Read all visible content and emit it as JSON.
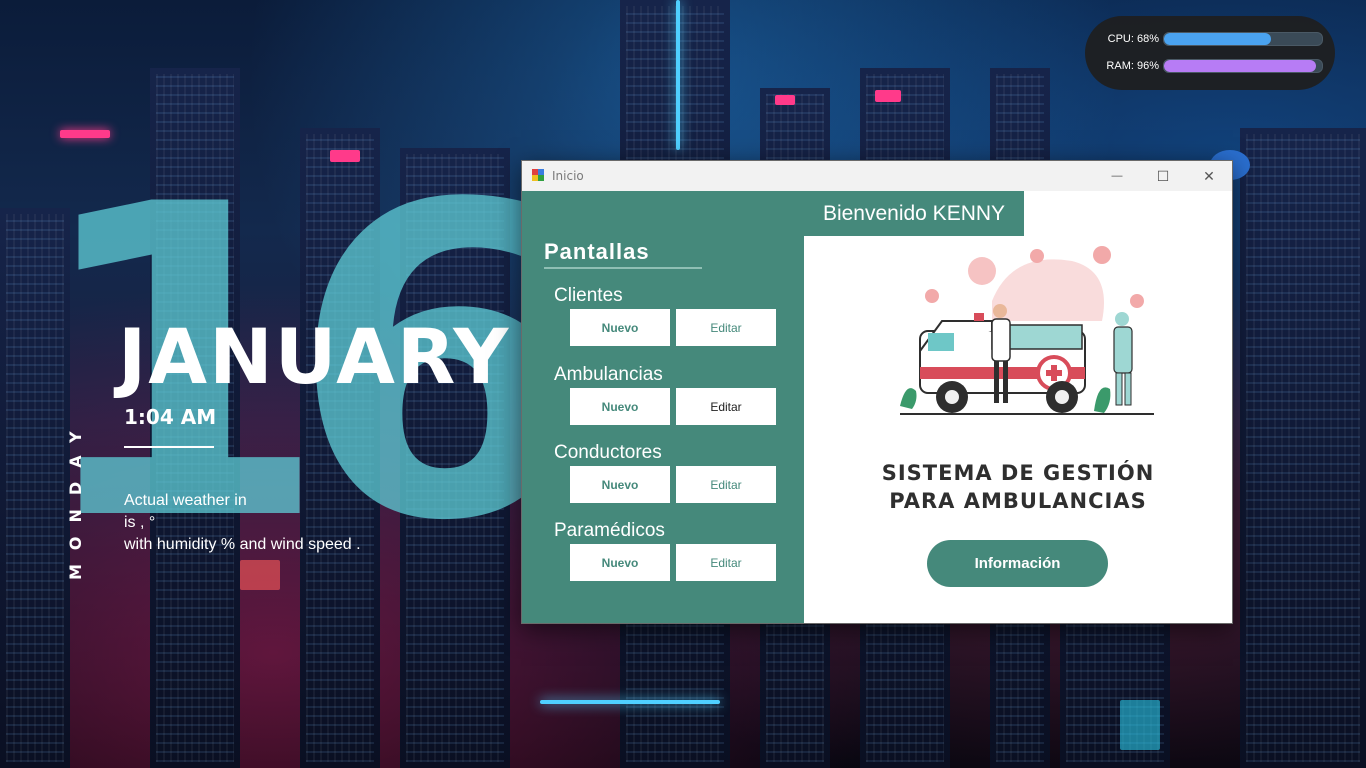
{
  "desktop": {
    "day_number": "16",
    "month": "JANUARY",
    "time": "1:04 AM",
    "weekday": "MONDAY",
    "weather": {
      "line1": "Actual weather in",
      "line2": "is , °",
      "line3": "with humidity  % and wind speed  ."
    }
  },
  "system_monitor": {
    "cpu": {
      "label": "CPU: 68%",
      "value_percent": 68,
      "color": "#4aa3f0"
    },
    "ram": {
      "label": "RAM: 96%",
      "value_percent": 96,
      "color": "#b77cf5"
    }
  },
  "window": {
    "title": "Inicio",
    "controls": {
      "minimize": "—",
      "maximize": "☐",
      "close": "✕"
    },
    "accent_color": "#45897b",
    "welcome": "Bienvenido KENNY",
    "panel_title": "Pantallas",
    "sections": [
      {
        "label": "Clientes",
        "new_label": "Nuevo",
        "edit_label": "Editar"
      },
      {
        "label": "Ambulancias",
        "new_label": "Nuevo",
        "edit_label": "Editar"
      },
      {
        "label": "Conductores",
        "new_label": "Nuevo",
        "edit_label": "Editar"
      },
      {
        "label": "Paramédicos",
        "new_label": "Nuevo",
        "edit_label": "Editar"
      }
    ],
    "headline_line1": "SISTEMA DE GESTIÓN",
    "headline_line2": "PARA AMBULANCIAS",
    "info_button": "Información",
    "illustration": "ambulance-with-medical-staff-illustration"
  }
}
